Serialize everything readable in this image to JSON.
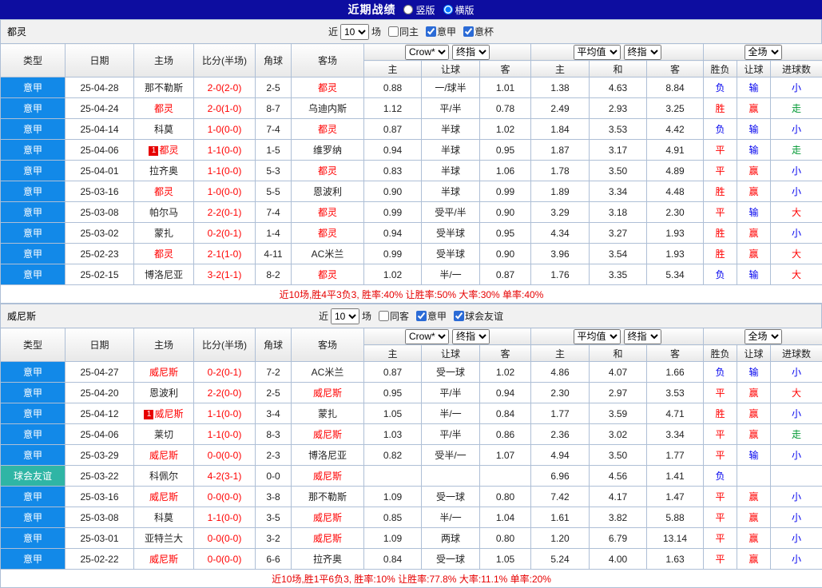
{
  "topbar": {
    "title": "近期战绩",
    "radios": [
      {
        "label": "竖版",
        "selected": false
      },
      {
        "label": "横版",
        "selected": true
      }
    ]
  },
  "colors": {
    "header_bar": "#0d0da0",
    "league_blue": "#1289e8",
    "friendly_teal": "#2fb5a5",
    "highlight_red": "#ff0000",
    "summary_red": "#e60000",
    "border": "#aebfd6",
    "result_colors": {
      "胜": "#ff0000",
      "平": "#ff0000",
      "负": "#0000ee",
      "赢": "#ff0000",
      "输": "#0000ee",
      "大": "#ff0000",
      "小": "#0000ee",
      "走": "#009933"
    }
  },
  "headers": {
    "left": [
      "类型",
      "日期",
      "主场",
      "比分(半场)",
      "角球",
      "客场"
    ],
    "group1_selects": [
      "Crow*",
      "终指"
    ],
    "group1_cols": [
      "主",
      "让球",
      "客"
    ],
    "group2_selects": [
      "平均值",
      "终指"
    ],
    "group2_cols": [
      "主",
      "和",
      "客"
    ],
    "group3_selects": [
      "全场"
    ],
    "group3_cols": [
      "胜负",
      "让球",
      "进球数"
    ]
  },
  "filter_labels": {
    "prefix": "近",
    "suffix": "场"
  },
  "sections": [
    {
      "team": "都灵",
      "match_count": "10",
      "checkboxes": [
        {
          "label": "同主",
          "checked": false
        },
        {
          "label": "意甲",
          "checked": true
        },
        {
          "label": "意杯",
          "checked": true
        }
      ],
      "rows": [
        {
          "type": "意甲",
          "style": "league",
          "date": "25-04-28",
          "home": "那不勒斯",
          "home_hl": false,
          "home_badge": "",
          "score": "2-0(2-0)",
          "corner": "2-5",
          "away": "都灵",
          "away_hl": true,
          "odds": [
            "0.88",
            "一/球半",
            "1.01"
          ],
          "avg": [
            "1.38",
            "4.63",
            "8.84"
          ],
          "result": [
            "负",
            "输",
            "小"
          ]
        },
        {
          "type": "意甲",
          "style": "league",
          "date": "25-04-24",
          "home": "都灵",
          "home_hl": true,
          "home_badge": "",
          "score": "2-0(1-0)",
          "corner": "8-7",
          "away": "乌迪内斯",
          "away_hl": false,
          "odds": [
            "1.12",
            "平/半",
            "0.78"
          ],
          "avg": [
            "2.49",
            "2.93",
            "3.25"
          ],
          "result": [
            "胜",
            "赢",
            "走"
          ]
        },
        {
          "type": "意甲",
          "style": "league",
          "date": "25-04-14",
          "home": "科莫",
          "home_hl": false,
          "home_badge": "",
          "score": "1-0(0-0)",
          "corner": "7-4",
          "away": "都灵",
          "away_hl": true,
          "odds": [
            "0.87",
            "半球",
            "1.02"
          ],
          "avg": [
            "1.84",
            "3.53",
            "4.42"
          ],
          "result": [
            "负",
            "输",
            "小"
          ]
        },
        {
          "type": "意甲",
          "style": "league",
          "date": "25-04-06",
          "home": "都灵",
          "home_hl": true,
          "home_badge": "1",
          "score": "1-1(0-0)",
          "corner": "1-5",
          "away": "维罗纳",
          "away_hl": false,
          "odds": [
            "0.94",
            "半球",
            "0.95"
          ],
          "avg": [
            "1.87",
            "3.17",
            "4.91"
          ],
          "result": [
            "平",
            "输",
            "走"
          ]
        },
        {
          "type": "意甲",
          "style": "league",
          "date": "25-04-01",
          "home": "拉齐奥",
          "home_hl": false,
          "home_badge": "",
          "score": "1-1(0-0)",
          "corner": "5-3",
          "away": "都灵",
          "away_hl": true,
          "odds": [
            "0.83",
            "半球",
            "1.06"
          ],
          "avg": [
            "1.78",
            "3.50",
            "4.89"
          ],
          "result": [
            "平",
            "赢",
            "小"
          ]
        },
        {
          "type": "意甲",
          "style": "league",
          "date": "25-03-16",
          "home": "都灵",
          "home_hl": true,
          "home_badge": "",
          "score": "1-0(0-0)",
          "corner": "5-5",
          "away": "恩波利",
          "away_hl": false,
          "odds": [
            "0.90",
            "半球",
            "0.99"
          ],
          "avg": [
            "1.89",
            "3.34",
            "4.48"
          ],
          "result": [
            "胜",
            "赢",
            "小"
          ]
        },
        {
          "type": "意甲",
          "style": "league",
          "date": "25-03-08",
          "home": "帕尔马",
          "home_hl": false,
          "home_badge": "",
          "score": "2-2(0-1)",
          "corner": "7-4",
          "away": "都灵",
          "away_hl": true,
          "odds": [
            "0.99",
            "受平/半",
            "0.90"
          ],
          "avg": [
            "3.29",
            "3.18",
            "2.30"
          ],
          "result": [
            "平",
            "输",
            "大"
          ]
        },
        {
          "type": "意甲",
          "style": "league",
          "date": "25-03-02",
          "home": "蒙扎",
          "home_hl": false,
          "home_badge": "",
          "score": "0-2(0-1)",
          "corner": "1-4",
          "away": "都灵",
          "away_hl": true,
          "odds": [
            "0.94",
            "受半球",
            "0.95"
          ],
          "avg": [
            "4.34",
            "3.27",
            "1.93"
          ],
          "result": [
            "胜",
            "赢",
            "小"
          ]
        },
        {
          "type": "意甲",
          "style": "league",
          "date": "25-02-23",
          "home": "都灵",
          "home_hl": true,
          "home_badge": "",
          "score": "2-1(1-0)",
          "corner": "4-11",
          "away": "AC米兰",
          "away_hl": false,
          "odds": [
            "0.99",
            "受半球",
            "0.90"
          ],
          "avg": [
            "3.96",
            "3.54",
            "1.93"
          ],
          "result": [
            "胜",
            "赢",
            "大"
          ]
        },
        {
          "type": "意甲",
          "style": "league",
          "date": "25-02-15",
          "home": "博洛尼亚",
          "home_hl": false,
          "home_badge": "",
          "score": "3-2(1-1)",
          "corner": "8-2",
          "away": "都灵",
          "away_hl": true,
          "odds": [
            "1.02",
            "半/一",
            "0.87"
          ],
          "avg": [
            "1.76",
            "3.35",
            "5.34"
          ],
          "result": [
            "负",
            "输",
            "大"
          ]
        }
      ],
      "summary": "近10场,胜4平3负3, 胜率:40% 让胜率:50% 大率:30% 单率:40%"
    },
    {
      "team": "威尼斯",
      "match_count": "10",
      "checkboxes": [
        {
          "label": "同客",
          "checked": false
        },
        {
          "label": "意甲",
          "checked": true
        },
        {
          "label": "球会友谊",
          "checked": true
        }
      ],
      "rows": [
        {
          "type": "意甲",
          "style": "league",
          "date": "25-04-27",
          "home": "威尼斯",
          "home_hl": true,
          "home_badge": "",
          "score": "0-2(0-1)",
          "corner": "7-2",
          "away": "AC米兰",
          "away_hl": false,
          "odds": [
            "0.87",
            "受一球",
            "1.02"
          ],
          "avg": [
            "4.86",
            "4.07",
            "1.66"
          ],
          "result": [
            "负",
            "输",
            "小"
          ]
        },
        {
          "type": "意甲",
          "style": "league",
          "date": "25-04-20",
          "home": "恩波利",
          "home_hl": false,
          "home_badge": "",
          "score": "2-2(0-0)",
          "corner": "2-5",
          "away": "威尼斯",
          "away_hl": true,
          "odds": [
            "0.95",
            "平/半",
            "0.94"
          ],
          "avg": [
            "2.30",
            "2.97",
            "3.53"
          ],
          "result": [
            "平",
            "赢",
            "大"
          ]
        },
        {
          "type": "意甲",
          "style": "league",
          "date": "25-04-12",
          "home": "威尼斯",
          "home_hl": true,
          "home_badge": "1",
          "score": "1-1(0-0)",
          "corner": "3-4",
          "away": "蒙扎",
          "away_hl": false,
          "odds": [
            "1.05",
            "半/一",
            "0.84"
          ],
          "avg": [
            "1.77",
            "3.59",
            "4.71"
          ],
          "result": [
            "胜",
            "赢",
            "小"
          ]
        },
        {
          "type": "意甲",
          "style": "league",
          "date": "25-04-06",
          "home": "莱切",
          "home_hl": false,
          "home_badge": "",
          "score": "1-1(0-0)",
          "corner": "8-3",
          "away": "威尼斯",
          "away_hl": true,
          "odds": [
            "1.03",
            "平/半",
            "0.86"
          ],
          "avg": [
            "2.36",
            "3.02",
            "3.34"
          ],
          "result": [
            "平",
            "赢",
            "走"
          ]
        },
        {
          "type": "意甲",
          "style": "league",
          "date": "25-03-29",
          "home": "威尼斯",
          "home_hl": true,
          "home_badge": "",
          "score": "0-0(0-0)",
          "corner": "2-3",
          "away": "博洛尼亚",
          "away_hl": false,
          "odds": [
            "0.82",
            "受半/一",
            "1.07"
          ],
          "avg": [
            "4.94",
            "3.50",
            "1.77"
          ],
          "result": [
            "平",
            "输",
            "小"
          ]
        },
        {
          "type": "球会友谊",
          "style": "friendly",
          "date": "25-03-22",
          "home": "科佩尔",
          "home_hl": false,
          "home_badge": "",
          "score": "4-2(3-1)",
          "corner": "0-0",
          "away": "威尼斯",
          "away_hl": true,
          "odds": [
            "",
            "",
            ""
          ],
          "avg": [
            "6.96",
            "4.56",
            "1.41"
          ],
          "result": [
            "负",
            "",
            ""
          ]
        },
        {
          "type": "意甲",
          "style": "league",
          "date": "25-03-16",
          "home": "威尼斯",
          "home_hl": true,
          "home_badge": "",
          "score": "0-0(0-0)",
          "corner": "3-8",
          "away": "那不勒斯",
          "away_hl": false,
          "odds": [
            "1.09",
            "受一球",
            "0.80"
          ],
          "avg": [
            "7.42",
            "4.17",
            "1.47"
          ],
          "result": [
            "平",
            "赢",
            "小"
          ]
        },
        {
          "type": "意甲",
          "style": "league",
          "date": "25-03-08",
          "home": "科莫",
          "home_hl": false,
          "home_badge": "",
          "score": "1-1(0-0)",
          "corner": "3-5",
          "away": "威尼斯",
          "away_hl": true,
          "odds": [
            "0.85",
            "半/一",
            "1.04"
          ],
          "avg": [
            "1.61",
            "3.82",
            "5.88"
          ],
          "result": [
            "平",
            "赢",
            "小"
          ]
        },
        {
          "type": "意甲",
          "style": "league",
          "date": "25-03-01",
          "home": "亚特兰大",
          "home_hl": false,
          "home_badge": "",
          "score": "0-0(0-0)",
          "corner": "3-2",
          "away": "威尼斯",
          "away_hl": true,
          "odds": [
            "1.09",
            "两球",
            "0.80"
          ],
          "avg": [
            "1.20",
            "6.79",
            "13.14"
          ],
          "result": [
            "平",
            "赢",
            "小"
          ]
        },
        {
          "type": "意甲",
          "style": "league",
          "date": "25-02-22",
          "home": "威尼斯",
          "home_hl": true,
          "home_badge": "",
          "score": "0-0(0-0)",
          "corner": "6-6",
          "away": "拉齐奥",
          "away_hl": false,
          "odds": [
            "0.84",
            "受一球",
            "1.05"
          ],
          "avg": [
            "5.24",
            "4.00",
            "1.63"
          ],
          "result": [
            "平",
            "赢",
            "小"
          ]
        }
      ],
      "summary": "近10场,胜1平6负3, 胜率:10% 让胜率:77.8% 大率:11.1% 单率:20%"
    }
  ]
}
